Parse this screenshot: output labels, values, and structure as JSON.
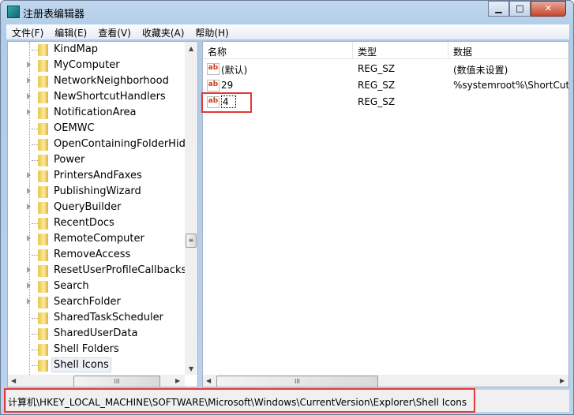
{
  "window": {
    "title": "注册表编辑器",
    "controls": {
      "minimize": "▁",
      "maximize": "□",
      "close": "✕"
    }
  },
  "menu": [
    "文件(F)",
    "编辑(E)",
    "查看(V)",
    "收藏夹(A)",
    "帮助(H)"
  ],
  "tree": [
    {
      "label": "KindMap",
      "expandable": false
    },
    {
      "label": "MyComputer",
      "expandable": true
    },
    {
      "label": "NetworkNeighborhood",
      "expandable": true
    },
    {
      "label": "NewShortcutHandlers",
      "expandable": true
    },
    {
      "label": "NotificationArea",
      "expandable": true
    },
    {
      "label": "OEMWC",
      "expandable": false
    },
    {
      "label": "OpenContainingFolderHidde",
      "expandable": false
    },
    {
      "label": "Power",
      "expandable": false
    },
    {
      "label": "PrintersAndFaxes",
      "expandable": true
    },
    {
      "label": "PublishingWizard",
      "expandable": true
    },
    {
      "label": "QueryBuilder",
      "expandable": true
    },
    {
      "label": "RecentDocs",
      "expandable": false
    },
    {
      "label": "RemoteComputer",
      "expandable": true
    },
    {
      "label": "RemoveAccess",
      "expandable": false
    },
    {
      "label": "ResetUserProfileCallbacks",
      "expandable": true
    },
    {
      "label": "Search",
      "expandable": true
    },
    {
      "label": "SearchFolder",
      "expandable": true
    },
    {
      "label": "SharedTaskScheduler",
      "expandable": false
    },
    {
      "label": "SharedUserData",
      "expandable": false
    },
    {
      "label": "Shell Folders",
      "expandable": false
    },
    {
      "label": "Shell Icons",
      "expandable": false,
      "selected": true
    }
  ],
  "columns": {
    "name": "名称",
    "type": "类型",
    "data": "数据"
  },
  "values": [
    {
      "name": "(默认)",
      "type": "REG_SZ",
      "data": "(数值未设置)",
      "icon": "ab"
    },
    {
      "name": "29",
      "type": "REG_SZ",
      "data": "%systemroot%\\ShortCut.",
      "icon": "ab"
    },
    {
      "name": "4",
      "type": "REG_SZ",
      "data": "",
      "icon": "ab",
      "editing": true
    }
  ],
  "status": {
    "path": "计算机\\HKEY_LOCAL_MACHINE\\SOFTWARE\\Microsoft\\Windows\\CurrentVersion\\Explorer\\Shell Icons"
  },
  "highlight_color": "#e53838"
}
